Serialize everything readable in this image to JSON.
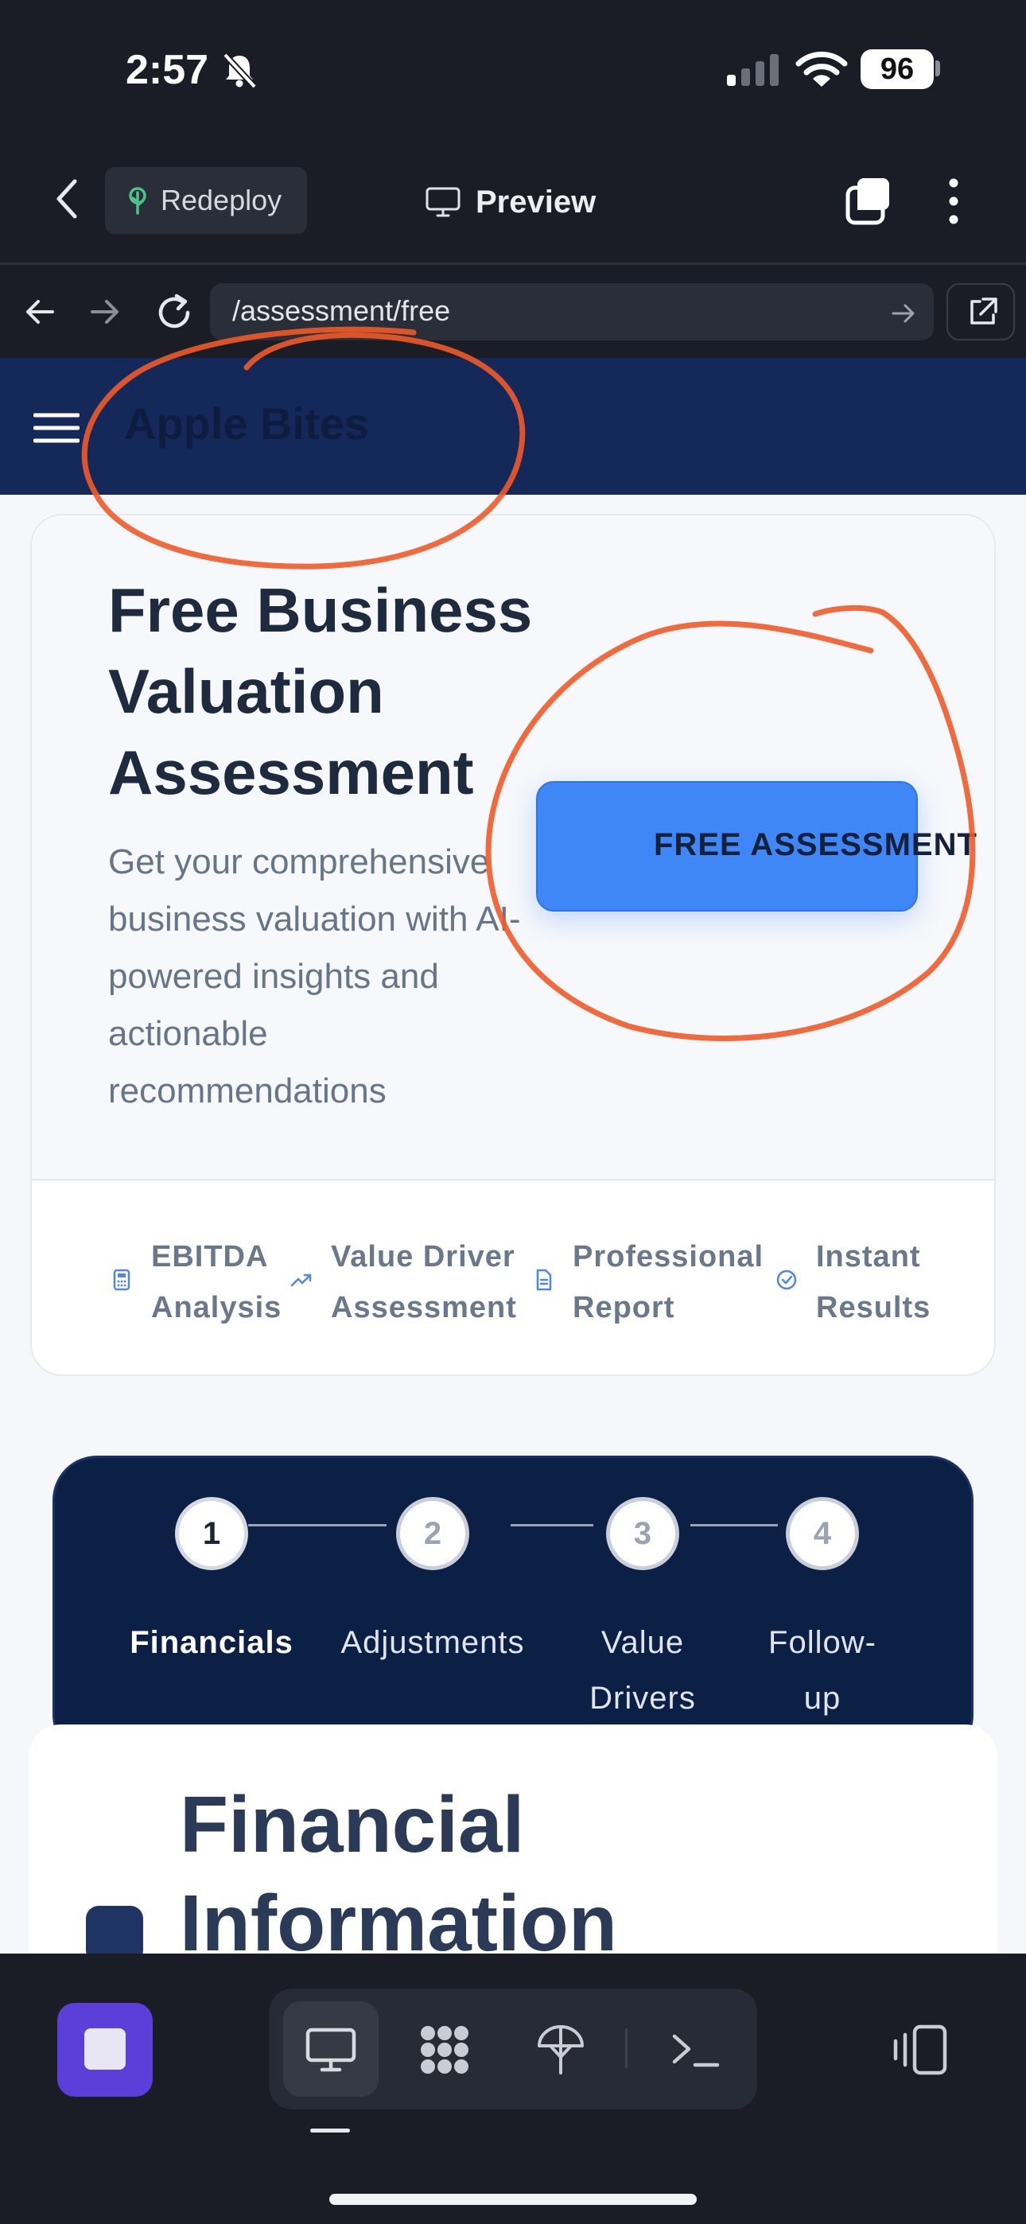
{
  "status_bar": {
    "time": "2:57",
    "battery": "96"
  },
  "app_bar": {
    "redeploy_label": "Redeploy",
    "preview_label": "Preview"
  },
  "browser": {
    "url": "/assessment/free"
  },
  "site": {
    "brand": "Apple Bites"
  },
  "hero": {
    "title": "Free Business Valuation Assessment",
    "subtitle": "Get your comprehensive business valuation with AI-powered insights and actionable recommendations",
    "cta_label": "FREE ASSESSMENT"
  },
  "features": [
    {
      "label": "EBITDA Analysis",
      "icon": "calculator-icon"
    },
    {
      "label": "Value Driver Assessment",
      "icon": "trend-up-icon"
    },
    {
      "label": "Professional Report",
      "icon": "document-icon"
    },
    {
      "label": "Instant Results",
      "icon": "check-circle-icon"
    }
  ],
  "steps": [
    {
      "number": "1",
      "label": "Financials",
      "active": true
    },
    {
      "number": "2",
      "label": "Adjustments",
      "active": false
    },
    {
      "number": "3",
      "label": "Value Drivers",
      "active": false
    },
    {
      "number": "4",
      "label": "Follow-up",
      "active": false
    }
  ],
  "section": {
    "title": "Financial Information"
  },
  "colors": {
    "chrome": "#1a1d26",
    "header": "#14295a",
    "cta": "#3f86f6",
    "stepper": "#0c1f45",
    "annotation": "#f05a28",
    "stop_button": "#5b3fd8"
  }
}
